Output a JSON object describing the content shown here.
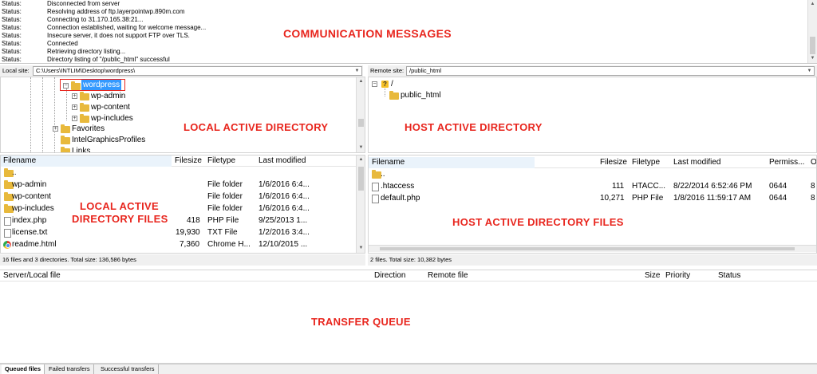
{
  "log": [
    {
      "type": "Status:",
      "msg": "Disconnected from server"
    },
    {
      "type": "Status:",
      "msg": "Resolving address of ftp.layerpointwp.890m.com"
    },
    {
      "type": "Status:",
      "msg": "Connecting to 31.170.165.38:21..."
    },
    {
      "type": "Status:",
      "msg": "Connection established, waiting for welcome message..."
    },
    {
      "type": "Status:",
      "msg": "Insecure server, it does not support FTP over TLS."
    },
    {
      "type": "Status:",
      "msg": "Connected"
    },
    {
      "type": "Status:",
      "msg": "Retrieving directory listing..."
    },
    {
      "type": "Status:",
      "msg": "Directory listing of \"/public_html\" successful"
    }
  ],
  "annotations": {
    "communication": "COMMUNICATION MESSAGES",
    "local_dir": "LOCAL ACTIVE DIRECTORY",
    "host_dir": "HOST ACTIVE DIRECTORY",
    "local_files_1": "LOCAL ACTIVE",
    "local_files_2": "DIRECTORY FILES",
    "host_files": "HOST ACTIVE DIRECTORY FILES",
    "transfer_queue": "TRANSFER QUEUE"
  },
  "local_site": {
    "label": "Local site:",
    "path": "C:\\Users\\INTLIM\\Desktop\\wordpress\\",
    "tree": [
      "wordpress",
      "wp-admin",
      "wp-content",
      "wp-includes",
      "Favorites",
      "IntelGraphicsProfiles",
      "Links"
    ]
  },
  "remote_site": {
    "label": "Remote site:",
    "path": "/public_html",
    "tree": [
      "/",
      "public_html"
    ]
  },
  "local_files": {
    "headers": [
      "Filename",
      "Filesize",
      "Filetype",
      "Last modified"
    ],
    "rows": [
      {
        "name": "..",
        "size": "",
        "type": "",
        "modified": "",
        "icon": "folder-icon"
      },
      {
        "name": "wp-admin",
        "size": "",
        "type": "File folder",
        "modified": "1/6/2016 6:4...",
        "icon": "folder-icon"
      },
      {
        "name": "wp-content",
        "size": "",
        "type": "File folder",
        "modified": "1/6/2016 6:4...",
        "icon": "folder-icon"
      },
      {
        "name": "wp-includes",
        "size": "",
        "type": "File folder",
        "modified": "1/6/2016 6:4...",
        "icon": "folder-icon"
      },
      {
        "name": "index.php",
        "size": "418",
        "type": "PHP File",
        "modified": "9/25/2013 1...",
        "icon": "file-icon"
      },
      {
        "name": "license.txt",
        "size": "19,930",
        "type": "TXT File",
        "modified": "1/2/2016 3:4...",
        "icon": "file-icon"
      },
      {
        "name": "readme.html",
        "size": "7,360",
        "type": "Chrome H...",
        "modified": "12/10/2015 ...",
        "icon": "chrome-icon"
      }
    ],
    "status": "16 files and 3 directories. Total size: 136,586 bytes"
  },
  "remote_files": {
    "headers": [
      "Filename",
      "Filesize",
      "Filetype",
      "Last modified",
      "Permiss...",
      "O"
    ],
    "rows": [
      {
        "name": "..",
        "size": "",
        "type": "",
        "modified": "",
        "perm": "",
        "owner": "",
        "icon": "folder-icon"
      },
      {
        "name": ".htaccess",
        "size": "111",
        "type": "HTACC...",
        "modified": "8/22/2014 6:52:46 PM",
        "perm": "0644",
        "owner": "8",
        "icon": "file-icon"
      },
      {
        "name": "default.php",
        "size": "10,271",
        "type": "PHP File",
        "modified": "1/8/2016 11:59:17 AM",
        "perm": "0644",
        "owner": "8",
        "icon": "file-icon"
      }
    ],
    "status": "2 files. Total size: 10,382 bytes"
  },
  "queue": {
    "headers": [
      "Server/Local file",
      "Direction",
      "Remote file",
      "Size",
      "Priority",
      "Status"
    ]
  },
  "tabs": [
    "Queued files",
    "Failed transfers",
    "Successful transfers"
  ]
}
